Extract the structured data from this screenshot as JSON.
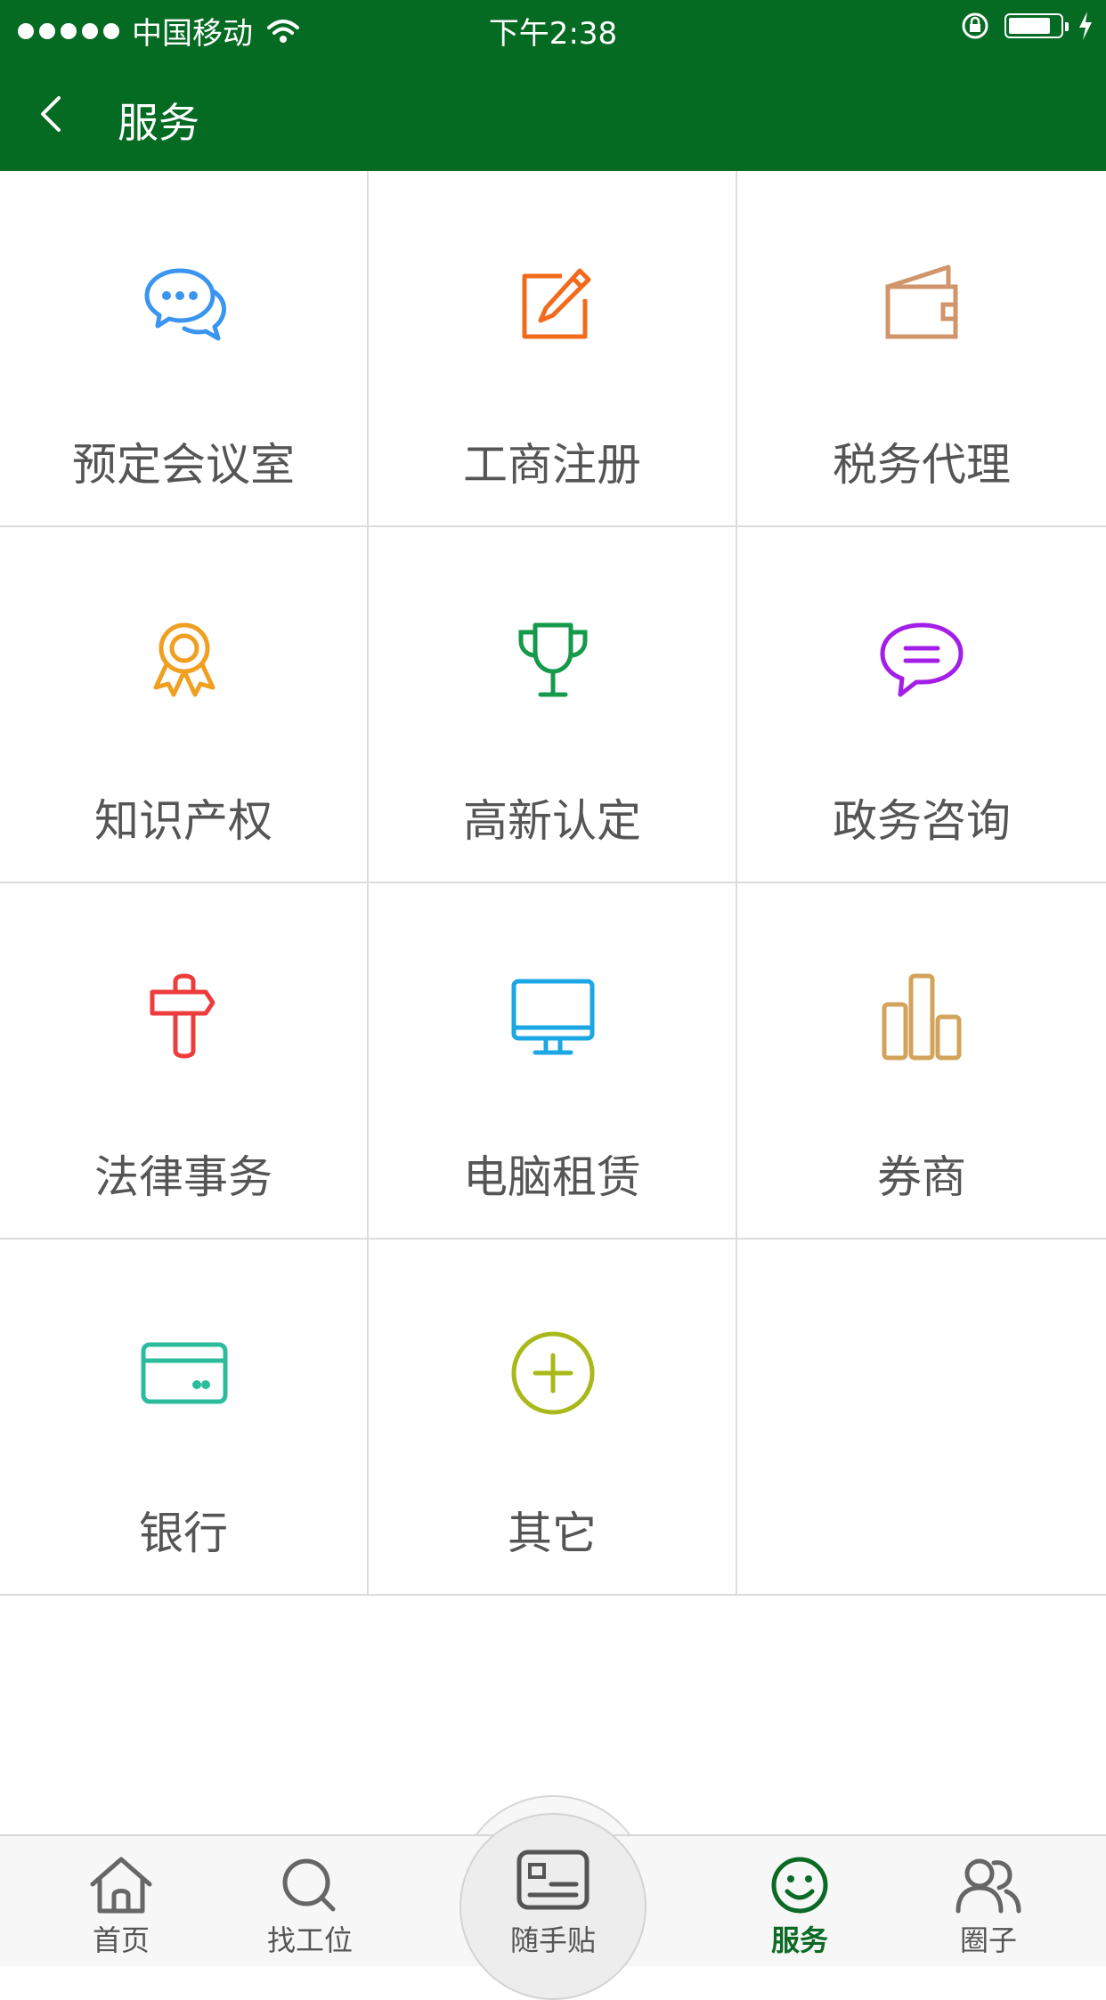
{
  "status_bar": {
    "carrier": "中国移动",
    "time": "下午2:38"
  },
  "nav": {
    "title": "服务"
  },
  "services": [
    {
      "label": "预定会议室",
      "icon": "chat-bubbles-icon",
      "color": "#3a95f0"
    },
    {
      "label": "工商注册",
      "icon": "edit-icon",
      "color": "#f26a1b"
    },
    {
      "label": "税务代理",
      "icon": "wallet-icon",
      "color": "#d0956a"
    },
    {
      "label": "知识产权",
      "icon": "award-ribbon-icon",
      "color": "#f0a020"
    },
    {
      "label": "高新认定",
      "icon": "trophy-icon",
      "color": "#159a4c"
    },
    {
      "label": "政务咨询",
      "icon": "message-icon",
      "color": "#a31ee8"
    },
    {
      "label": "法律事务",
      "icon": "signpost-icon",
      "color": "#ee3b3b"
    },
    {
      "label": "电脑租赁",
      "icon": "monitor-icon",
      "color": "#1ba6e4"
    },
    {
      "label": "券商",
      "icon": "bar-chart-icon",
      "color": "#d2a35a"
    },
    {
      "label": "银行",
      "icon": "card-icon",
      "color": "#2bbd9b"
    },
    {
      "label": "其它",
      "icon": "plus-circle-icon",
      "color": "#a9b91a"
    }
  ],
  "tabs": {
    "home": "首页",
    "find": "找工位",
    "post": "随手贴",
    "service": "服务",
    "circle": "圈子",
    "active": "service",
    "active_color": "#0b6a24"
  }
}
